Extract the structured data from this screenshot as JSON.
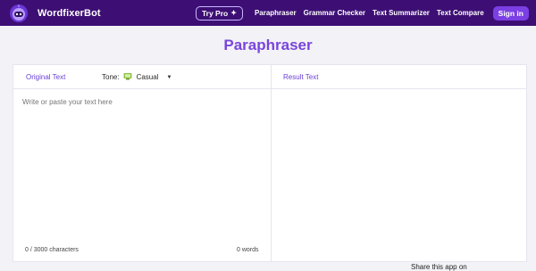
{
  "brand": {
    "name": "WordfixerBot"
  },
  "nav": {
    "try_pro": "Try Pro",
    "links": [
      "Paraphraser",
      "Grammar Checker",
      "Text Summarizer",
      "Text Compare"
    ],
    "sign_in": "Sign in"
  },
  "page": {
    "title": "Paraphraser"
  },
  "editor": {
    "original_label": "Original Text",
    "tone_label": "Tone:",
    "tone_value": "Casual",
    "result_label": "Result Text",
    "placeholder": "Write or paste your text here",
    "char_count": "0 / 3000 characters",
    "word_count": "0 words"
  },
  "footer": {
    "share_text": "Share this app on"
  },
  "colors": {
    "nav_bg": "#3d0f74",
    "accent": "#7a45dc",
    "signin_bg": "#7b3fe4"
  },
  "icons": {
    "logo": "robot-logo-icon",
    "sparkle": "sparkle-icon",
    "tone": "tone-emoji-icon",
    "caret": "caret-down-icon"
  }
}
